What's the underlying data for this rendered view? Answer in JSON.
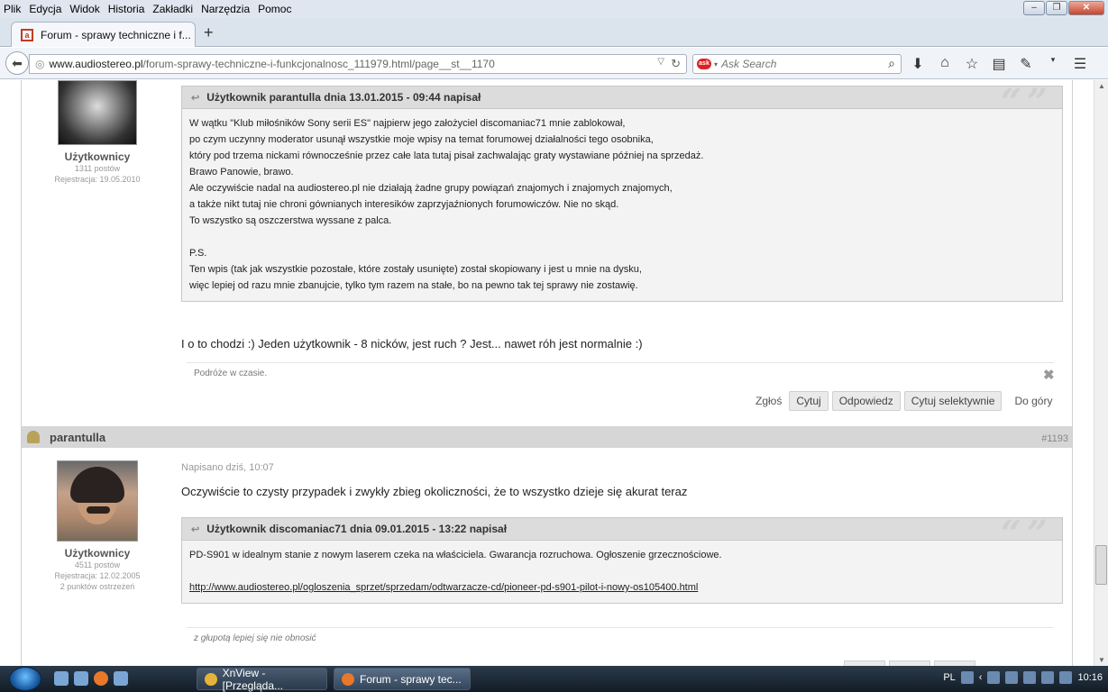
{
  "menu": [
    "Plik",
    "Edycja",
    "Widok",
    "Historia",
    "Zakładki",
    "Narzędzia",
    "Pomoc"
  ],
  "tab": {
    "title": "Forum - sprawy techniczne i f..."
  },
  "url": {
    "domain": "www.audiostereo.pl",
    "path": "/forum-sprawy-techniczne-i-funkcjonalnosc_111979.html/page__st__1170"
  },
  "search": {
    "placeholder": "Ask Search"
  },
  "post1": {
    "role": "Użytkownicy",
    "posts": "1311 postów",
    "registered": "Rejestracja: 19.05.2010",
    "quote_header": "Użytkownik parantulla dnia 13.01.2015 - 09:44 napisał",
    "quote_lines": [
      "W wątku \"Klub miłośników Sony serii ES\" najpierw jego założyciel discomaniac71 mnie zablokował,",
      "po czym uczynny moderator usunął wszystkie moje wpisy na temat forumowej działalności tego osobnika,",
      "który pod trzema nickami równocześnie przez całe lata tutaj pisał zachwalając graty wystawiane później na sprzedaż.",
      "Brawo Panowie, brawo.",
      "Ale oczywiście nadal na audiostereo.pl nie działają żadne grupy powiązań znajomych i znajomych znajomych,",
      "a także nikt tutaj nie chroni gównianych interesików zaprzyjaźnionych forumowiczów. Nie no skąd.",
      "To wszystko są oszczerstwa wyssane z palca.",
      "",
      "P.S.",
      "Ten wpis (tak jak wszystkie pozostałe, które zostały usunięte) został skopiowany i jest u mnie na dysku,",
      "więc lepiej od razu mnie zbanujcie, tylko tym razem na stałe, bo na pewno tak tej sprawy nie zostawię."
    ],
    "text": "I o to chodzi :) Jeden użytkownik - 8 nicków, jest ruch ? Jest... nawet róh jest normalnie :)",
    "signature": "Podróże w czasie.",
    "actions": {
      "report": "Zgłoś",
      "quote": "Cytuj",
      "reply": "Odpowiedz",
      "quote_sel": "Cytuj selektywnie",
      "top": "Do góry"
    }
  },
  "post2": {
    "username": "parantulla",
    "post_number": "#1193",
    "posted": "Napisano dziś, 10:07",
    "text": "Oczywiście to czysty przypadek i zwykły zbieg okoliczności, że to wszystko dzieje się akurat teraz",
    "role": "Użytkownicy",
    "posts": "4511 postów",
    "registered": "Rejestracja: 12.02.2005",
    "warnings": "2 punktów ostrzeżeń",
    "quote_header": "Użytkownik discomaniac71 dnia 09.01.2015 - 13:22 napisał",
    "quote_line": "PD-S901 w idealnym stanie z nowym laserem czeka na właściciela. Gwarancja rozruchowa. Ogłoszenie grzecznościowe.",
    "quote_link": "http://www.audiostereo.pl/ogloszenia_sprzet/sprzedam/odtwarzacze-cd/pioneer-pd-s901-pilot-i-nowy-os105400.html",
    "signature": "z głupotą lepiej się nie obnosić"
  },
  "taskbar": {
    "tasks": [
      "XnView - [Przegląda...",
      "Forum - sprawy tec..."
    ],
    "lang": "PL",
    "clock": "10:16"
  }
}
